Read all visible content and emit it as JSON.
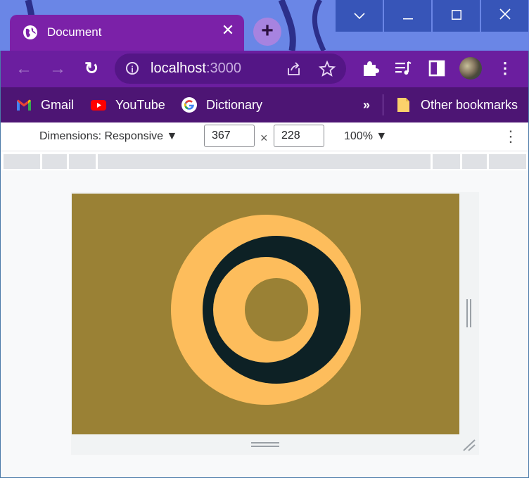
{
  "tab": {
    "title": "Document",
    "close_glyph": "✕",
    "icon": "globe-icon"
  },
  "new_tab": {
    "glyph": "+"
  },
  "window_controls": {
    "tabsearch": "⌄",
    "minimize": "—",
    "maximize": "☐",
    "close": "✕"
  },
  "toolbar": {
    "back": "←",
    "forward": "→",
    "reload": "↻",
    "url_host": "localhost",
    "url_port": ":3000",
    "icons": [
      "info-icon",
      "share-icon",
      "star-icon",
      "extensions-icon",
      "media-control-icon",
      "side-panel-icon",
      "profile-avatar",
      "menu-icon"
    ]
  },
  "bookmarks": {
    "items": [
      {
        "label": "Gmail",
        "icon": "gmail-icon"
      },
      {
        "label": "YouTube",
        "icon": "youtube-icon"
      },
      {
        "label": "Dictionary",
        "icon": "google-icon"
      }
    ],
    "overflow": "»",
    "other": "Other bookmarks"
  },
  "device_toolbar": {
    "dimensions_label": "Dimensions: Responsive ▼",
    "width": "367",
    "times": "×",
    "height": "228",
    "zoom": "100% ▼",
    "more": "⋮"
  },
  "colors": {
    "page_bg": "#9a8135",
    "ring_light": "#fdbd5c",
    "ring_dark": "#0d2125",
    "tab_bg": "#7b21a8",
    "toolbar_bg": "#6b1e9f",
    "bookmarks_bg": "#4d1574"
  }
}
